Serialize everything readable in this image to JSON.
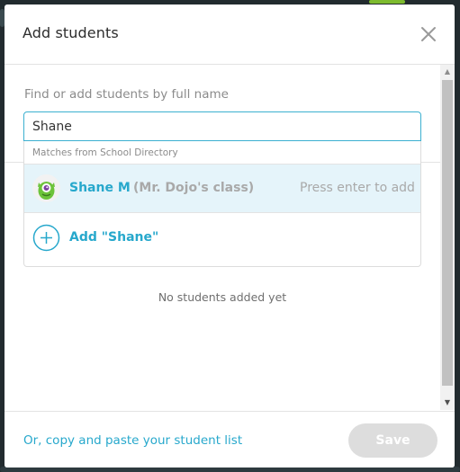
{
  "modal": {
    "title": "Add students",
    "close_icon": "close-icon"
  },
  "search": {
    "label": "Find or add students by full name",
    "value": "Shane",
    "placeholder": ""
  },
  "dropdown": {
    "header": "Matches from School Directory",
    "match": {
      "avatar_icon": "monster-avatar-icon",
      "name": "Shane M",
      "class": "(Mr. Dojo's class)",
      "hint": "Press enter to add"
    },
    "add": {
      "icon": "plus-circle-icon",
      "label": "Add \"Shane\""
    }
  },
  "body": {
    "empty_text": "No students added yet"
  },
  "footer": {
    "copy_link": "Or, copy and paste your student list",
    "save_label": "Save"
  },
  "colors": {
    "accent": "#27a8cc",
    "highlight_row": "#e5f4fa",
    "muted": "#a9a9a9",
    "disabled_button": "#dddddd"
  }
}
